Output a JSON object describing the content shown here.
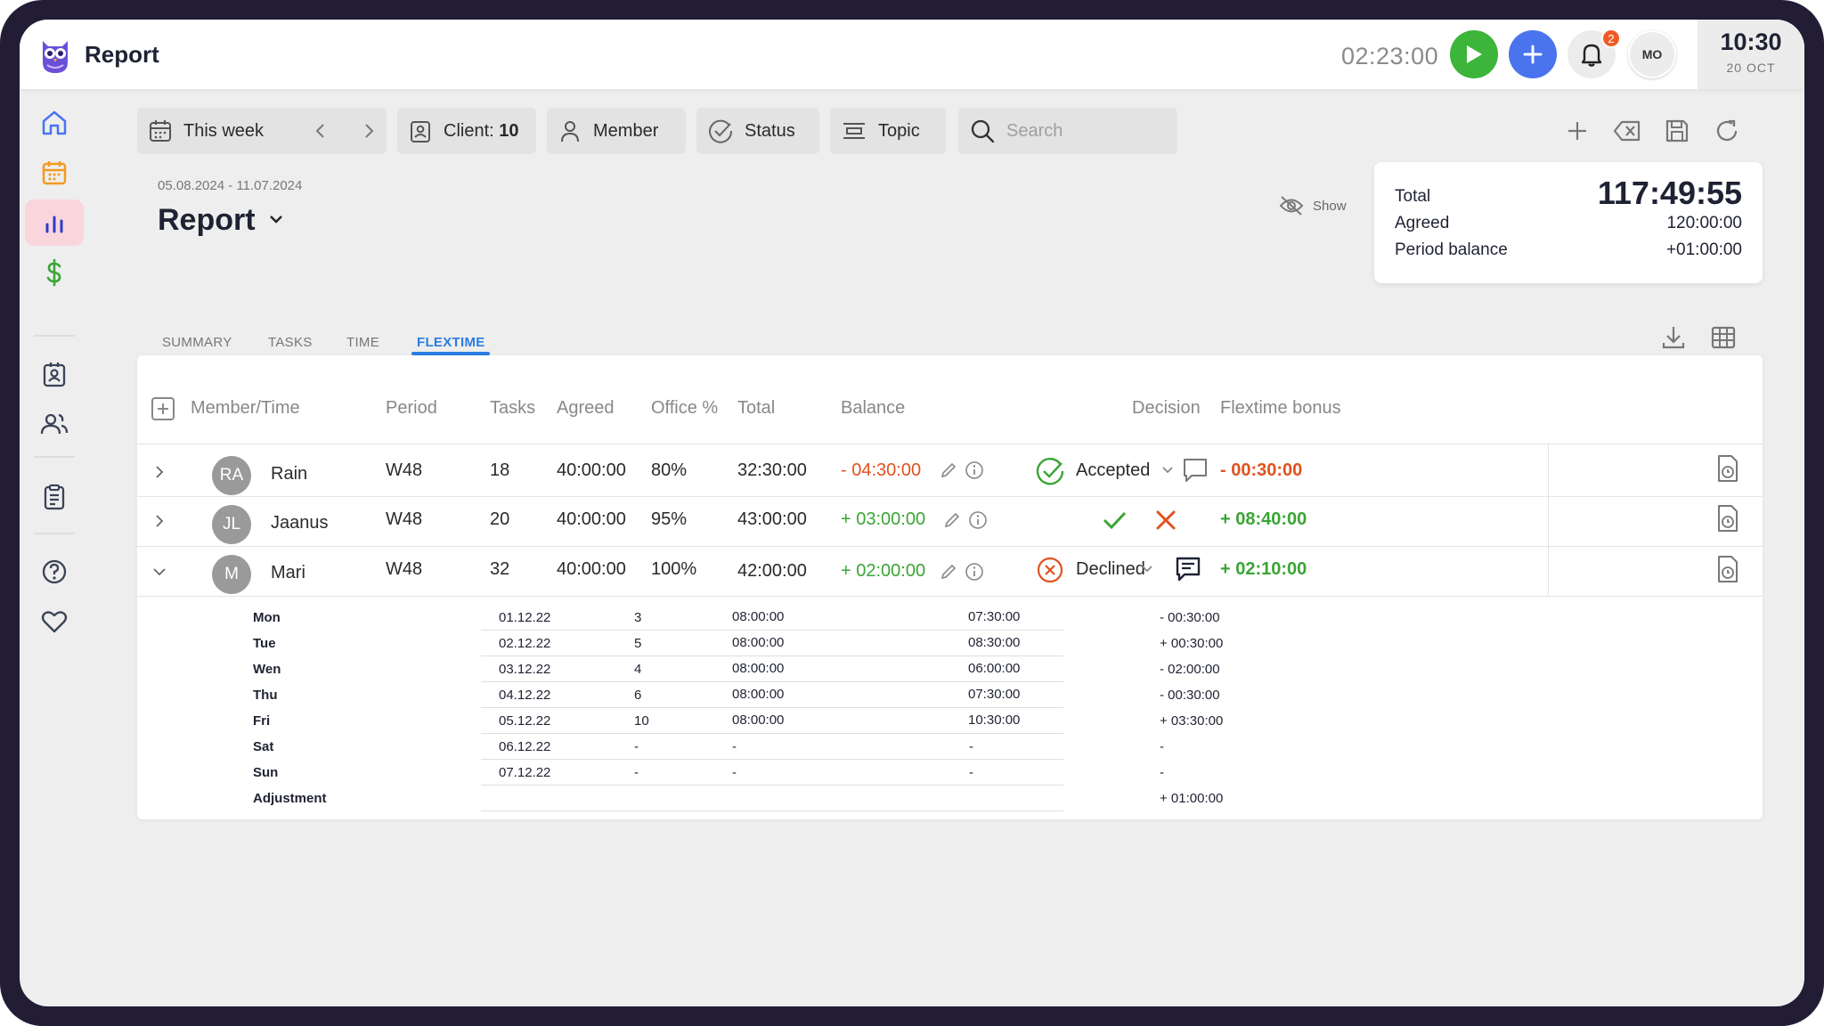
{
  "app": {
    "title": "Report",
    "timer": "02:23:00",
    "notifications_count": "2",
    "user_initials": "MO",
    "clock_time": "10:30",
    "clock_date": "20 OCT"
  },
  "colors": {
    "accent_blue": "#2a7de1",
    "play_green": "#3db43a",
    "add_blue": "#4a73ee",
    "negative": "#e0531e",
    "positive": "#3aa535",
    "active_nav": "#f9d6dc"
  },
  "sidebar": {
    "items": [
      {
        "name": "home-icon",
        "active": false
      },
      {
        "name": "calendar-icon",
        "active": false
      },
      {
        "name": "bar-chart-icon",
        "active": true
      },
      {
        "name": "dollar-icon",
        "active": false
      },
      {
        "name": "contact-badge-icon",
        "active": false
      },
      {
        "name": "users-icon",
        "active": false
      },
      {
        "name": "clipboard-icon",
        "active": false
      },
      {
        "name": "help-icon",
        "active": false
      },
      {
        "name": "heart-icon",
        "active": false
      }
    ]
  },
  "filters": {
    "period": "This week",
    "client_label": "Client:",
    "client_value": "10",
    "member": "Member",
    "status": "Status",
    "topic": "Topic",
    "search_placeholder": "Search"
  },
  "header": {
    "date_range": "05.08.2024 - 11.07.2024",
    "page_title": "Report",
    "show_label": "Show"
  },
  "totals": {
    "total_label": "Total",
    "total_value": "117:49:55",
    "agreed_label": "Agreed",
    "agreed_value": "120:00:00",
    "balance_label": "Period balance",
    "balance_value": "+01:00:00"
  },
  "tabs": [
    "SUMMARY",
    "TASKS",
    "TIME",
    "FLEXTIME"
  ],
  "active_tab": "FLEXTIME",
  "table": {
    "columns": {
      "member": "Member/Time",
      "period": "Period",
      "tasks": "Tasks",
      "agreed": "Agreed",
      "office": "Office %",
      "total": "Total",
      "balance": "Balance",
      "decision": "Decision",
      "bonus": "Flextime bonus"
    },
    "rows": [
      {
        "initials": "RA",
        "name": "Rain",
        "period": "W48",
        "tasks": "18",
        "agreed": "40:00:00",
        "office": "80%",
        "total": "32:30:00",
        "balance": "- 04:30:00",
        "decision": "Accepted",
        "bonus": "- 00:30:00"
      },
      {
        "initials": "JL",
        "name": "Jaanus",
        "period": "W48",
        "tasks": "20",
        "agreed": "40:00:00",
        "office": "95%",
        "total": "43:00:00",
        "balance": "+ 03:00:00",
        "decision": "",
        "bonus": "+ 08:40:00"
      },
      {
        "initials": "M",
        "name": "Mari",
        "period": "W48",
        "tasks": "32",
        "agreed": "40:00:00",
        "office": "100%",
        "total": "42:00:00",
        "balance": "+ 02:00:00",
        "decision": "Declined",
        "bonus": "+ 02:10:00"
      }
    ],
    "days": [
      {
        "day": "Mon",
        "date": "01.12.22",
        "tasks": "3",
        "agreed": "08:00:00",
        "total": "07:30:00",
        "balance": "-  00:30:00"
      },
      {
        "day": "Tue",
        "date": "02.12.22",
        "tasks": "5",
        "agreed": "08:00:00",
        "total": "08:30:00",
        "balance": "+ 00:30:00"
      },
      {
        "day": "Wen",
        "date": "03.12.22",
        "tasks": "4",
        "agreed": "08:00:00",
        "total": "06:00:00",
        "balance": "-  02:00:00"
      },
      {
        "day": "Thu",
        "date": "04.12.22",
        "tasks": "6",
        "agreed": "08:00:00",
        "total": "07:30:00",
        "balance": "-  00:30:00"
      },
      {
        "day": "Fri",
        "date": "05.12.22",
        "tasks": "10",
        "agreed": "08:00:00",
        "total": "10:30:00",
        "balance": "+ 03:30:00"
      },
      {
        "day": "Sat",
        "date": "06.12.22",
        "tasks": "-",
        "agreed": "-",
        "total": "-",
        "balance": "-"
      },
      {
        "day": "Sun",
        "date": "07.12.22",
        "tasks": "-",
        "agreed": "-",
        "total": "-",
        "balance": "-"
      }
    ],
    "adjustment_label": "Adjustment",
    "adjustment_value": "+ 01:00:00"
  }
}
